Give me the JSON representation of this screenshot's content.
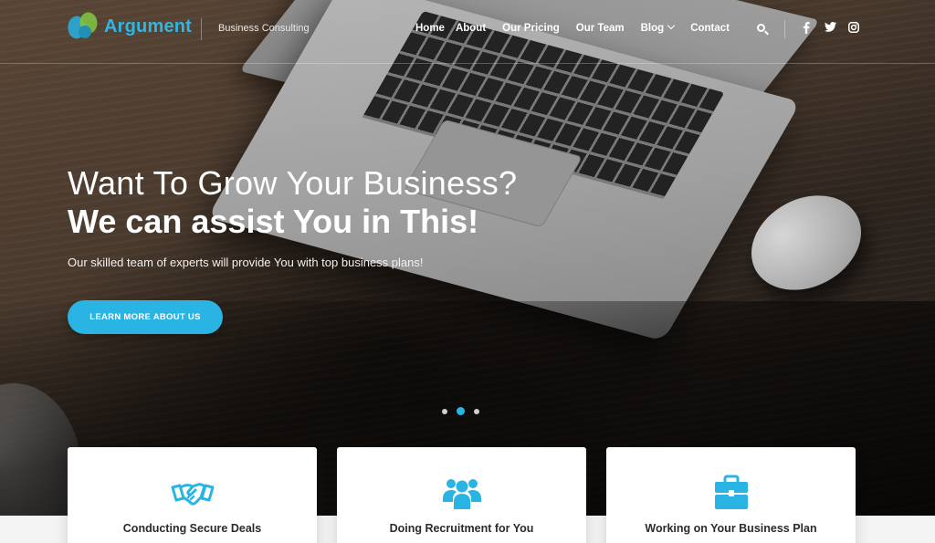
{
  "brand": {
    "name": "Argument",
    "tagline": "Business Consulting",
    "accent_color": "#2ab4e3"
  },
  "nav": {
    "items": [
      {
        "label": "Home"
      },
      {
        "label": "About"
      },
      {
        "label": "Our Pricing"
      },
      {
        "label": "Our Team"
      },
      {
        "label": "Blog"
      },
      {
        "label": "Contact"
      }
    ],
    "icons": [
      "search-icon",
      "facebook-icon",
      "twitter-icon",
      "instagram-icon"
    ]
  },
  "hero": {
    "title_line1": "Want To Grow Your Business?",
    "title_line2": "We can assist You in This!",
    "subtitle": "Our skilled team of experts will provide You with top business plans!",
    "cta_label": "LEARN MORE ABOUT US",
    "slides_count": 3,
    "active_slide": 2
  },
  "features": [
    {
      "title": "Conducting Secure Deals",
      "icon": "handshake-icon"
    },
    {
      "title": "Doing Recruitment for You",
      "icon": "team-icon"
    },
    {
      "title": "Working on Your Business Plan",
      "icon": "briefcase-icon"
    }
  ]
}
